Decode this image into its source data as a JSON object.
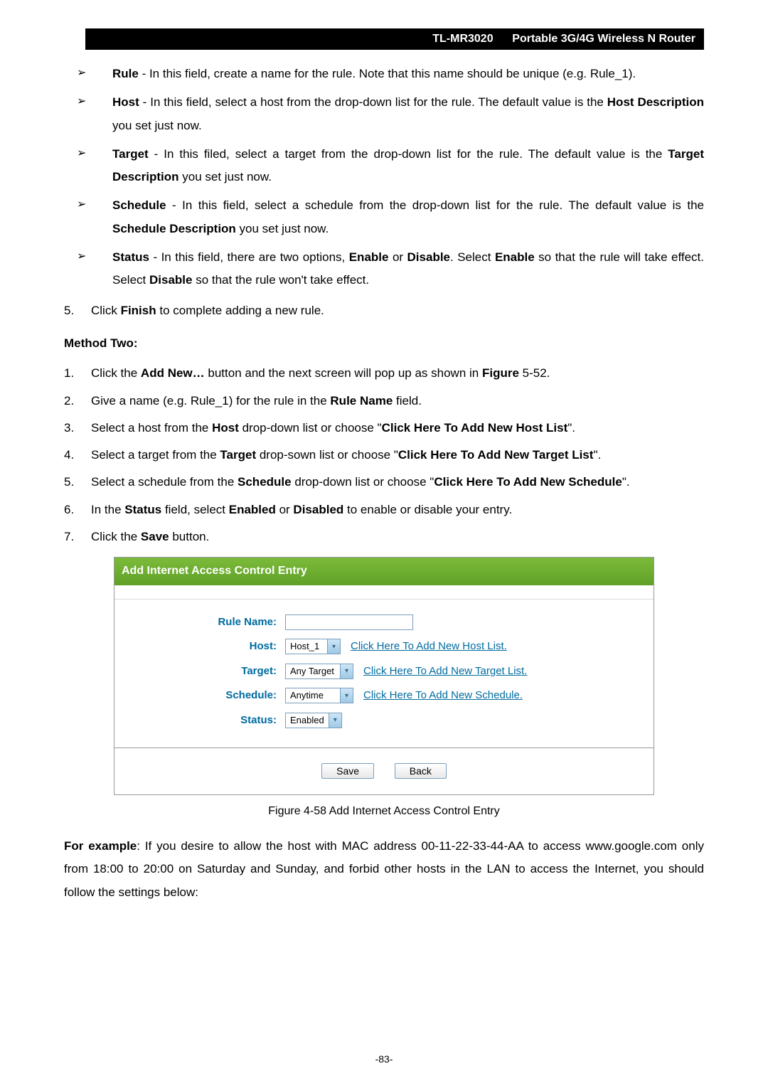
{
  "header": {
    "model": "TL-MR3020",
    "product": "Portable 3G/4G Wireless N Router"
  },
  "bullets": {
    "rule_title": "Rule",
    "rule_text": " - In this field, create a name for the rule. Note that this name should be unique (e.g. Rule_1).",
    "host_title": "Host",
    "host_text_a": " - In this field, select a host from the drop-down list for the rule. The default value is the ",
    "host_bold": "Host Description",
    "host_text_b": " you set just now.",
    "target_title": "Target",
    "target_text_a": " - In this filed, select a target from the drop-down list for the rule. The default value is the ",
    "target_bold": "Target Description",
    "target_text_b": " you set just now.",
    "schedule_title": "Schedule",
    "schedule_text_a": " - In this field, select a schedule from the drop-down list for the rule. The default value is the ",
    "schedule_bold": "Schedule Description",
    "schedule_text_b": " you set just now.",
    "status_title": "Status",
    "status_text_a": " - In this field, there are two options, ",
    "status_enable": "Enable",
    "status_text_b": " or ",
    "status_disable": "Disable",
    "status_text_c": ". Select ",
    "status_text_d": " so that the rule will take effect. Select ",
    "status_text_e": " so that the rule won't take effect."
  },
  "step5": {
    "num": "5.",
    "text_a": "Click ",
    "bold": "Finish",
    "text_b": " to complete adding a new rule."
  },
  "method_two": "Method Two:",
  "steps": {
    "s1": {
      "num": "1.",
      "a": "Click the ",
      "b1": "Add New…",
      "b": " button and the next screen will pop up as shown in ",
      "b2": "Figure ",
      "c": "5-52."
    },
    "s2": {
      "num": "2.",
      "a": "Give a name (e.g. Rule_1) for the rule in the ",
      "b1": "Rule Name",
      "b": " field."
    },
    "s3": {
      "num": "3.",
      "a": "Select a host from the ",
      "b1": "Host",
      "b": " drop-down list or choose \"",
      "b2": "Click Here To Add New Host List",
      "c": "\"."
    },
    "s4": {
      "num": "4.",
      "a": "Select a target from the ",
      "b1": "Target",
      "b": " drop-sown list or choose \"",
      "b2": "Click Here To Add New Target List",
      "c": "\"."
    },
    "s5": {
      "num": "5.",
      "a": "Select a schedule from the ",
      "b1": "Schedule",
      "b": " drop-down list or choose \"",
      "b2": "Click Here To Add New Schedule",
      "c": "\"."
    },
    "s6": {
      "num": "6.",
      "a": "In the ",
      "b1": "Status",
      "b": " field, select ",
      "b2": "Enabled",
      "c": " or ",
      "b3": "Disabled",
      "d": " to enable or disable your entry."
    },
    "s7": {
      "num": "7.",
      "a": "Click the ",
      "b1": "Save",
      "b": " button."
    }
  },
  "form": {
    "title": "Add Internet Access Control Entry",
    "labels": {
      "rule": "Rule Name:",
      "host": "Host:",
      "target": "Target:",
      "schedule": "Schedule:",
      "status": "Status:"
    },
    "values": {
      "host": "Host_1",
      "target": "Any Target",
      "schedule": "Anytime",
      "status": "Enabled"
    },
    "links": {
      "host": "Click Here To Add New Host List.",
      "target": "Click Here To Add New Target List.",
      "schedule": "Click Here To Add New Schedule."
    },
    "buttons": {
      "save": "Save",
      "back": "Back"
    }
  },
  "figure_caption": "Figure 4-58    Add Internet Access Control Entry",
  "example": {
    "bold": "For example",
    "text": ": If you desire to allow the host with MAC address 00-11-22-33-44-AA to access www.google.com only from 18:00 to 20:00 on Saturday and Sunday, and forbid other hosts in the LAN to access the Internet, you should follow the settings below:"
  },
  "page_num": "-83-"
}
